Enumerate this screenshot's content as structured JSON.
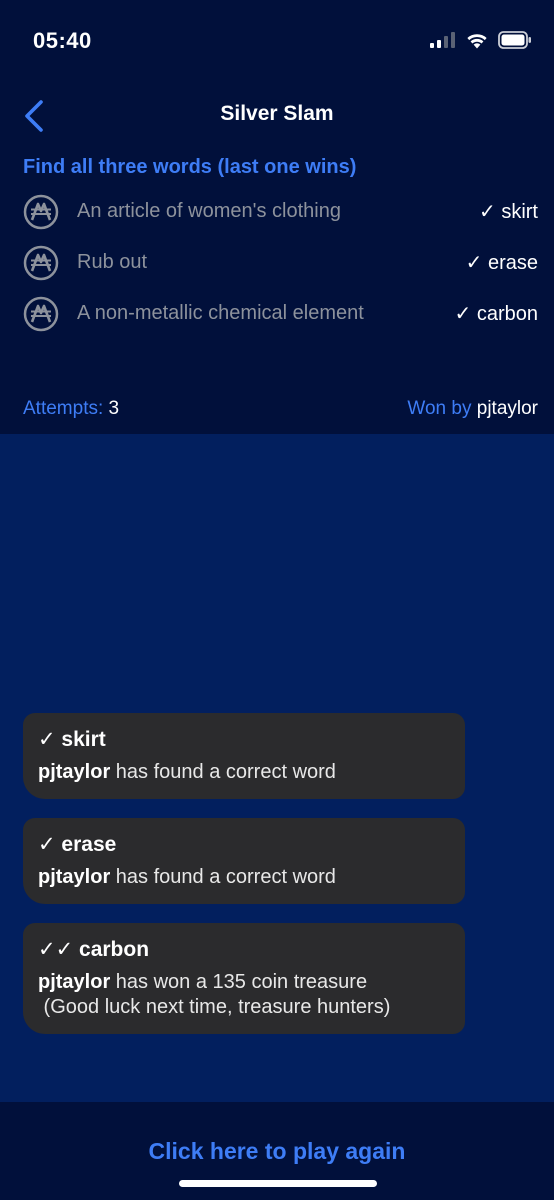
{
  "status_bar": {
    "time": "05:40"
  },
  "nav": {
    "title": "Silver Slam"
  },
  "puzzle": {
    "instructions": "Find all three words (last one wins)",
    "clues": [
      {
        "text": "An article of women's clothing",
        "answer": "✓ skirt"
      },
      {
        "text": "Rub out",
        "answer": "✓ erase"
      },
      {
        "text": "A non-metallic chemical element",
        "answer": "✓ carbon"
      }
    ]
  },
  "stats": {
    "attempts_label": "Attempts:",
    "attempts_value": "3",
    "won_by_label": "Won by",
    "won_by_value": "pjtaylor"
  },
  "messages": [
    {
      "heading": "✓ skirt",
      "user": "pjtaylor",
      "text": " has found a correct word",
      "extra": ""
    },
    {
      "heading": "✓ erase",
      "user": "pjtaylor",
      "text": " has found a correct word",
      "extra": ""
    },
    {
      "heading": "✓✓ carbon",
      "user": "pjtaylor",
      "text": " has won a 135 coin treasure",
      "extra": " (Good luck next time, treasure hunters)"
    }
  ],
  "footer": {
    "play_again": "Click here to play again"
  },
  "colors": {
    "header_bg": "#01103b",
    "content_bg": "#021f5e",
    "accent": "#3e7df6",
    "bubble_bg": "#2b2b2d"
  }
}
